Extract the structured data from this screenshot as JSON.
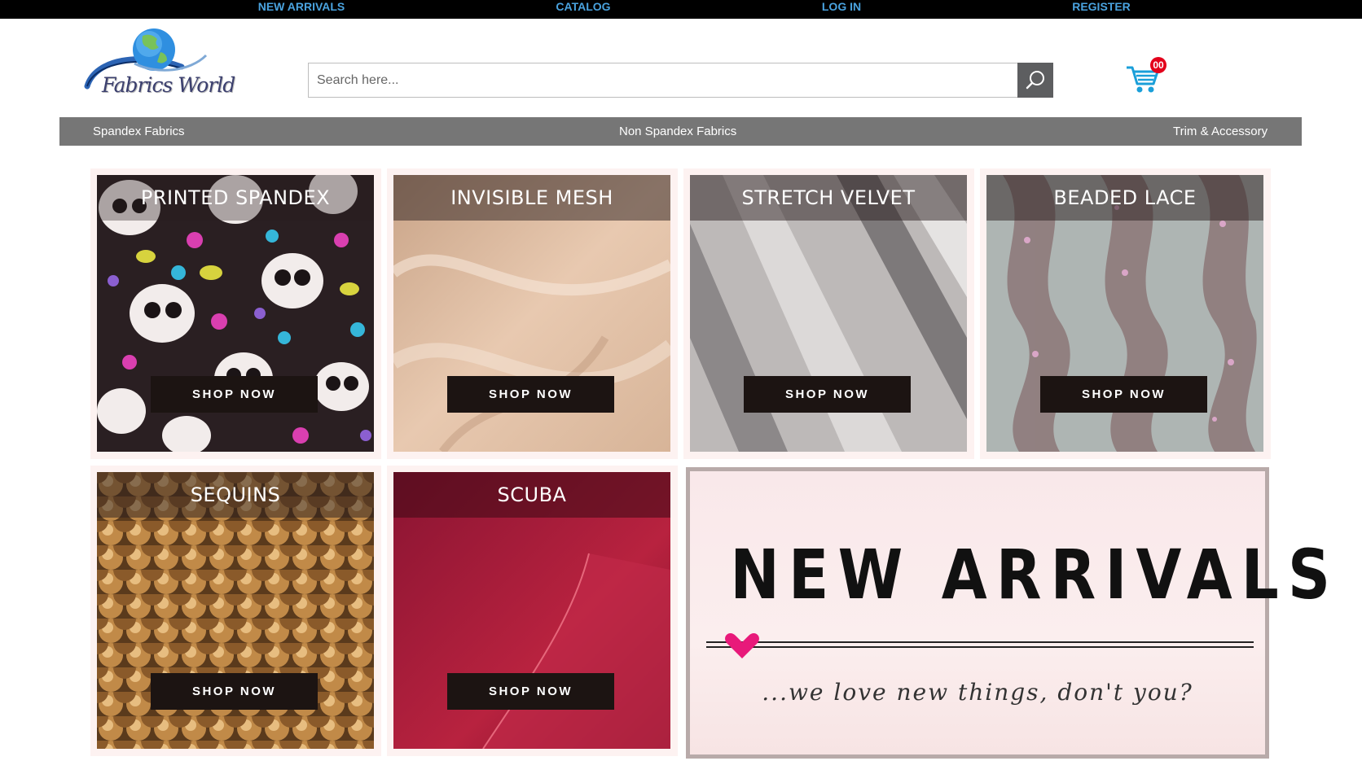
{
  "top_nav": [
    {
      "label": "NEW ARRIVALS"
    },
    {
      "label": "CATALOG"
    },
    {
      "label": "LOG IN"
    },
    {
      "label": "REGISTER"
    }
  ],
  "brand": {
    "name": "Fabrics World"
  },
  "search": {
    "placeholder": "Search here...",
    "value": ""
  },
  "cart": {
    "count": "00"
  },
  "category_nav": [
    {
      "label": "Spandex Fabrics"
    },
    {
      "label": "Non Spandex Fabrics"
    },
    {
      "label": "Trim & Accessory"
    }
  ],
  "tiles": [
    {
      "title": "PRINTED SPANDEX",
      "cta": "SHOP NOW"
    },
    {
      "title": "INVISIBLE MESH",
      "cta": "SHOP NOW"
    },
    {
      "title": "STRETCH VELVET",
      "cta": "SHOP NOW"
    },
    {
      "title": "BEADED LACE",
      "cta": "SHOP NOW"
    },
    {
      "title": "SEQUINS",
      "cta": "SHOP NOW"
    },
    {
      "title": "SCUBA",
      "cta": "SHOP NOW"
    }
  ],
  "banner": {
    "title": "NEW ARRIVALS",
    "tagline": "...we love new things, don't you?"
  },
  "colors": {
    "top_bar": "#000000",
    "top_link": "#4aa3df",
    "category_bar": "#767676",
    "cart_icon": "#1a9fd9",
    "cart_badge": "#e3001b",
    "shop_button": "#1c1412",
    "heart": "#e8197a"
  }
}
